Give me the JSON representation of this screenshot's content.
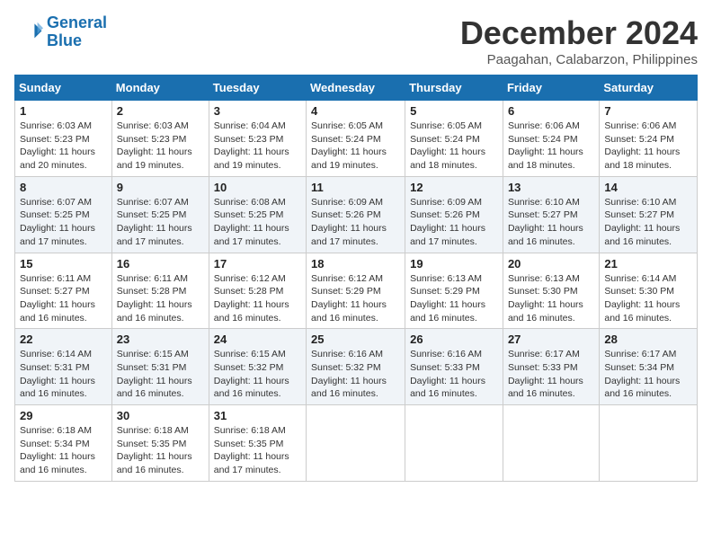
{
  "logo": {
    "line1": "General",
    "line2": "Blue"
  },
  "title": "December 2024",
  "location": "Paagahan, Calabarzon, Philippines",
  "headers": [
    "Sunday",
    "Monday",
    "Tuesday",
    "Wednesday",
    "Thursday",
    "Friday",
    "Saturday"
  ],
  "weeks": [
    [
      {
        "day": "1",
        "sunrise": "6:03 AM",
        "sunset": "5:23 PM",
        "daylight": "11 hours and 20 minutes."
      },
      {
        "day": "2",
        "sunrise": "6:03 AM",
        "sunset": "5:23 PM",
        "daylight": "11 hours and 19 minutes."
      },
      {
        "day": "3",
        "sunrise": "6:04 AM",
        "sunset": "5:23 PM",
        "daylight": "11 hours and 19 minutes."
      },
      {
        "day": "4",
        "sunrise": "6:05 AM",
        "sunset": "5:24 PM",
        "daylight": "11 hours and 19 minutes."
      },
      {
        "day": "5",
        "sunrise": "6:05 AM",
        "sunset": "5:24 PM",
        "daylight": "11 hours and 18 minutes."
      },
      {
        "day": "6",
        "sunrise": "6:06 AM",
        "sunset": "5:24 PM",
        "daylight": "11 hours and 18 minutes."
      },
      {
        "day": "7",
        "sunrise": "6:06 AM",
        "sunset": "5:24 PM",
        "daylight": "11 hours and 18 minutes."
      }
    ],
    [
      {
        "day": "8",
        "sunrise": "6:07 AM",
        "sunset": "5:25 PM",
        "daylight": "11 hours and 17 minutes."
      },
      {
        "day": "9",
        "sunrise": "6:07 AM",
        "sunset": "5:25 PM",
        "daylight": "11 hours and 17 minutes."
      },
      {
        "day": "10",
        "sunrise": "6:08 AM",
        "sunset": "5:25 PM",
        "daylight": "11 hours and 17 minutes."
      },
      {
        "day": "11",
        "sunrise": "6:09 AM",
        "sunset": "5:26 PM",
        "daylight": "11 hours and 17 minutes."
      },
      {
        "day": "12",
        "sunrise": "6:09 AM",
        "sunset": "5:26 PM",
        "daylight": "11 hours and 17 minutes."
      },
      {
        "day": "13",
        "sunrise": "6:10 AM",
        "sunset": "5:27 PM",
        "daylight": "11 hours and 16 minutes."
      },
      {
        "day": "14",
        "sunrise": "6:10 AM",
        "sunset": "5:27 PM",
        "daylight": "11 hours and 16 minutes."
      }
    ],
    [
      {
        "day": "15",
        "sunrise": "6:11 AM",
        "sunset": "5:27 PM",
        "daylight": "11 hours and 16 minutes."
      },
      {
        "day": "16",
        "sunrise": "6:11 AM",
        "sunset": "5:28 PM",
        "daylight": "11 hours and 16 minutes."
      },
      {
        "day": "17",
        "sunrise": "6:12 AM",
        "sunset": "5:28 PM",
        "daylight": "11 hours and 16 minutes."
      },
      {
        "day": "18",
        "sunrise": "6:12 AM",
        "sunset": "5:29 PM",
        "daylight": "11 hours and 16 minutes."
      },
      {
        "day": "19",
        "sunrise": "6:13 AM",
        "sunset": "5:29 PM",
        "daylight": "11 hours and 16 minutes."
      },
      {
        "day": "20",
        "sunrise": "6:13 AM",
        "sunset": "5:30 PM",
        "daylight": "11 hours and 16 minutes."
      },
      {
        "day": "21",
        "sunrise": "6:14 AM",
        "sunset": "5:30 PM",
        "daylight": "11 hours and 16 minutes."
      }
    ],
    [
      {
        "day": "22",
        "sunrise": "6:14 AM",
        "sunset": "5:31 PM",
        "daylight": "11 hours and 16 minutes."
      },
      {
        "day": "23",
        "sunrise": "6:15 AM",
        "sunset": "5:31 PM",
        "daylight": "11 hours and 16 minutes."
      },
      {
        "day": "24",
        "sunrise": "6:15 AM",
        "sunset": "5:32 PM",
        "daylight": "11 hours and 16 minutes."
      },
      {
        "day": "25",
        "sunrise": "6:16 AM",
        "sunset": "5:32 PM",
        "daylight": "11 hours and 16 minutes."
      },
      {
        "day": "26",
        "sunrise": "6:16 AM",
        "sunset": "5:33 PM",
        "daylight": "11 hours and 16 minutes."
      },
      {
        "day": "27",
        "sunrise": "6:17 AM",
        "sunset": "5:33 PM",
        "daylight": "11 hours and 16 minutes."
      },
      {
        "day": "28",
        "sunrise": "6:17 AM",
        "sunset": "5:34 PM",
        "daylight": "11 hours and 16 minutes."
      }
    ],
    [
      {
        "day": "29",
        "sunrise": "6:18 AM",
        "sunset": "5:34 PM",
        "daylight": "11 hours and 16 minutes."
      },
      {
        "day": "30",
        "sunrise": "6:18 AM",
        "sunset": "5:35 PM",
        "daylight": "11 hours and 16 minutes."
      },
      {
        "day": "31",
        "sunrise": "6:18 AM",
        "sunset": "5:35 PM",
        "daylight": "11 hours and 17 minutes."
      },
      null,
      null,
      null,
      null
    ]
  ]
}
